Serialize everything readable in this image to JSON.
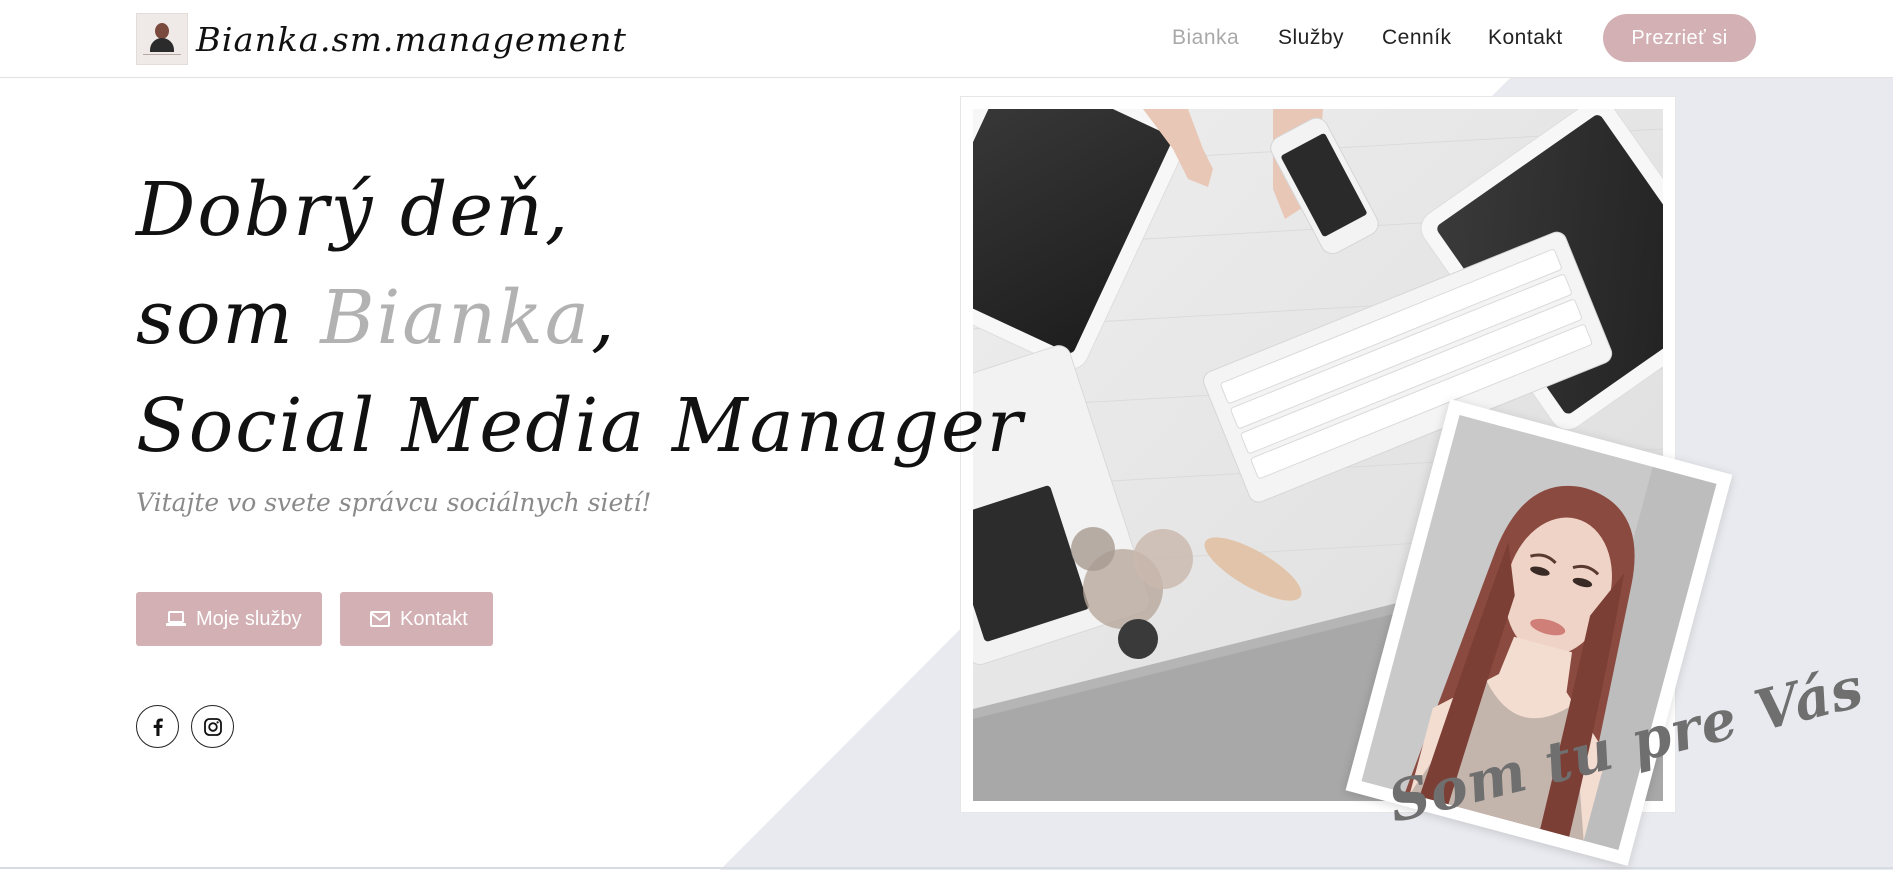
{
  "header": {
    "brand": "Bianka.sm.management",
    "nav": [
      {
        "label": "Bianka",
        "active": true
      },
      {
        "label": "Služby",
        "active": false
      },
      {
        "label": "Cenník",
        "active": false
      },
      {
        "label": "Kontakt",
        "active": false
      }
    ],
    "cta_label": "Prezrieť si"
  },
  "hero": {
    "line1": "Dobrý deň,",
    "line2_prefix": "som ",
    "line2_accent": "Bianka",
    "line2_suffix": ",",
    "line3": "Social Media Manager",
    "subtitle": "Vitajte vo svete správcu sociálnych sietí!"
  },
  "buttons": {
    "services_label": "Moje služby",
    "contact_label": "Kontakt"
  },
  "social": [
    {
      "icon": "facebook-icon"
    },
    {
      "icon": "instagram-icon"
    }
  ],
  "tagline": "Som tu pre Vás",
  "colors": {
    "accent": "#d2b0b4",
    "muted_text": "#a9a9a9",
    "background_shape": "#e9eaef"
  }
}
